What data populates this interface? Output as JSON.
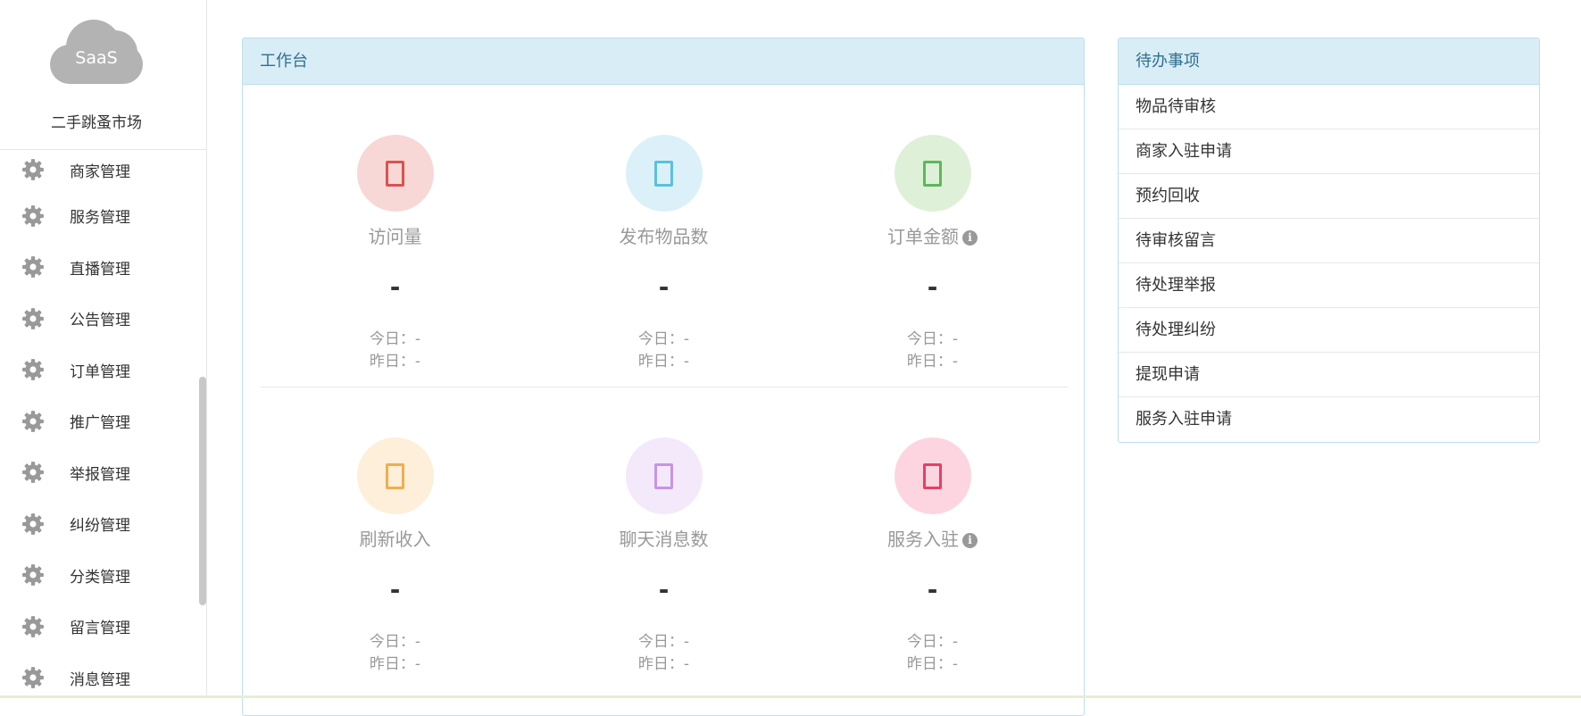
{
  "sidebar": {
    "logo_text": "SaaS",
    "site_name": "二手跳蚤市场",
    "items": [
      {
        "label": "商家管理",
        "icon": "gear-icon"
      },
      {
        "label": "服务管理",
        "icon": "gear-icon"
      },
      {
        "label": "直播管理",
        "icon": "gear-icon"
      },
      {
        "label": "公告管理",
        "icon": "gear-icon"
      },
      {
        "label": "订单管理",
        "icon": "gear-icon"
      },
      {
        "label": "推广管理",
        "icon": "gear-icon"
      },
      {
        "label": "举报管理",
        "icon": "gear-icon"
      },
      {
        "label": "纠纷管理",
        "icon": "gear-icon"
      },
      {
        "label": "分类管理",
        "icon": "gear-icon"
      },
      {
        "label": "留言管理",
        "icon": "gear-icon"
      },
      {
        "label": "消息管理",
        "icon": "gear-icon"
      }
    ]
  },
  "workbench": {
    "title": "工作台",
    "stats": [
      {
        "name": "访问量",
        "value": "-",
        "today": "今日：-",
        "yesterday": "昨日：-",
        "bg": "#f8d7d7",
        "color": "#d9534f",
        "info": false
      },
      {
        "name": "发布物品数",
        "value": "-",
        "today": "今日：-",
        "yesterday": "昨日：-",
        "bg": "#dbf0f8",
        "color": "#5bc0de",
        "info": false
      },
      {
        "name": "订单金额",
        "value": "-",
        "today": "今日：-",
        "yesterday": "昨日：-",
        "bg": "#dff0d8",
        "color": "#5cb85c",
        "info": true
      },
      {
        "name": "刷新收入",
        "value": "-",
        "today": "今日：-",
        "yesterday": "昨日：-",
        "bg": "#fdefd9",
        "color": "#f0ad4e",
        "info": false
      },
      {
        "name": "聊天消息数",
        "value": "-",
        "today": "今日：-",
        "yesterday": "昨日：-",
        "bg": "#f3e9fb",
        "color": "#c794e6",
        "info": false
      },
      {
        "name": "服务入驻",
        "value": "-",
        "today": "今日：-",
        "yesterday": "昨日：-",
        "bg": "#fdd5e0",
        "color": "#e83e66",
        "info": true
      }
    ]
  },
  "todo": {
    "title": "待办事项",
    "items": [
      "物品待审核",
      "商家入驻申请",
      "预约回收",
      "待审核留言",
      "待处理举报",
      "待处理纠纷",
      "提现申请",
      "服务入驻申请"
    ]
  }
}
